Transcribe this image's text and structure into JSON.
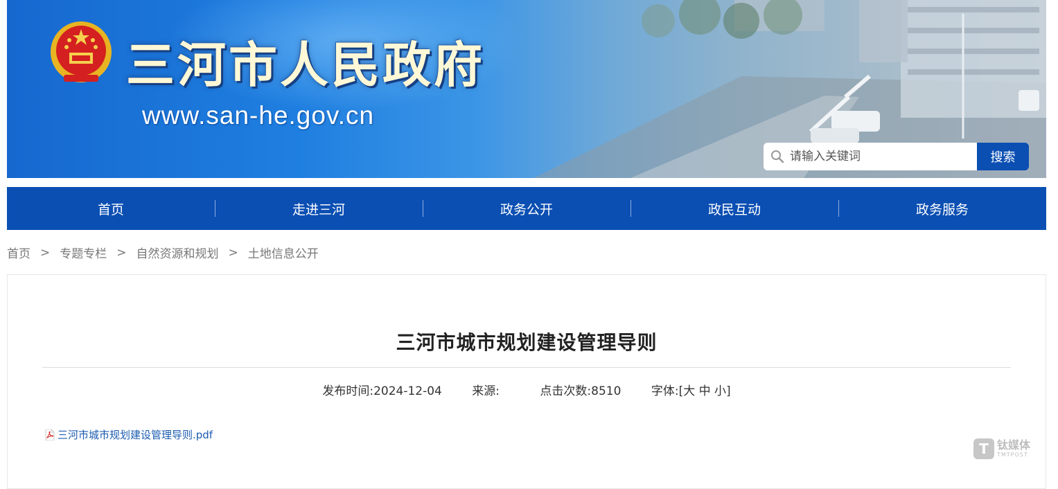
{
  "header": {
    "site_title": "三河市人民政府",
    "site_url": "www.san-he.gov.cn",
    "search_placeholder": "请输入关键词",
    "search_button": "搜索"
  },
  "nav": {
    "items": [
      "首页",
      "走进三河",
      "政务公开",
      "政民互动",
      "政务服务"
    ]
  },
  "breadcrumb": [
    "首页",
    "专题专栏",
    "自然资源和规划",
    "土地信息公开"
  ],
  "breadcrumb_sep": ">",
  "article": {
    "title": "三河市城市规划建设管理导则",
    "publish_label": "发布时间:",
    "publish_date": "2024-12-04",
    "source_label": "来源:",
    "source_value": "",
    "views_label": "点击次数:",
    "views_value": "8510",
    "font_label": "字体:",
    "font_open": "[",
    "font_large": "大",
    "font_medium": "中",
    "font_small": "小",
    "font_close": "]",
    "attachment": "三河市城市规划建设管理导则.pdf"
  },
  "watermark": {
    "letter": "T",
    "cn": "钛媒体",
    "en": "TMTPOST"
  },
  "colors": {
    "primary": "#0b4fb3",
    "link": "#1a5bb0"
  }
}
